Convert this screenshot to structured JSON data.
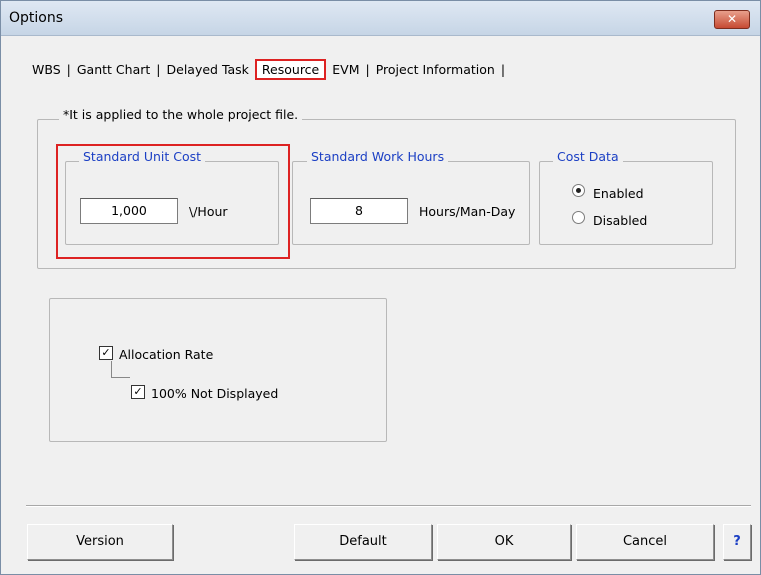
{
  "window": {
    "title": "Options",
    "close_glyph": "✕"
  },
  "tabs": [
    {
      "label": "WBS"
    },
    {
      "label": "Gantt Chart"
    },
    {
      "label": "Delayed Task"
    },
    {
      "label": "Resource",
      "active": true
    },
    {
      "label": "EVM"
    },
    {
      "label": "Project Information"
    }
  ],
  "project_group": {
    "legend": "*It is applied to the whole project file."
  },
  "unit_cost": {
    "legend": "Standard Unit Cost",
    "value": "1,000",
    "unit": "\\/Hour"
  },
  "work_hours": {
    "legend": "Standard Work Hours",
    "value": "8",
    "unit": "Hours/Man-Day"
  },
  "cost_data": {
    "legend": "Cost Data",
    "options": [
      {
        "label": "Enabled",
        "selected": true
      },
      {
        "label": "Disabled",
        "selected": false
      }
    ]
  },
  "allocation": {
    "rate_label": "Allocation Rate",
    "rate_checked": true,
    "not_displayed_label": "100% Not Displayed",
    "not_displayed_checked": true,
    "check_glyph": "✓"
  },
  "buttons": {
    "version": "Version",
    "default": "Default",
    "ok": "OK",
    "cancel": "Cancel",
    "help": "?"
  },
  "colors": {
    "highlight": "#dd2222",
    "legend_blue": "#1b3fc4"
  }
}
